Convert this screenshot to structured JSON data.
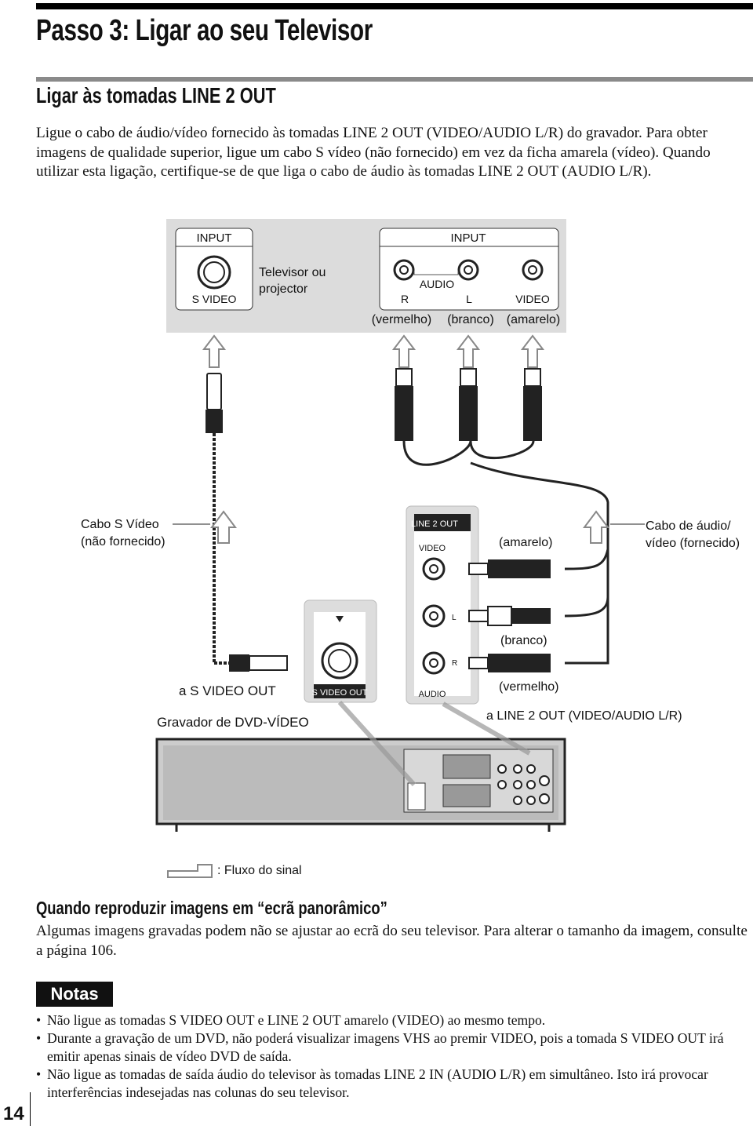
{
  "title": "Passo 3: Ligar ao seu Televisor",
  "section_title": "Ligar às tomadas LINE 2 OUT",
  "intro": "Ligue o cabo de áudio/vídeo fornecido às tomadas LINE 2 OUT (VIDEO/AUDIO L/R) do gravador. Para obter imagens de qualidade superior, ligue um cabo S vídeo (não fornecido) em vez da ficha amarela (vídeo). Quando utilizar esta ligação, certifique-se de que liga o cabo de áudio às tomadas LINE 2 OUT (AUDIO L/R).",
  "diagram": {
    "tv_input_left": "INPUT",
    "tv_input_right": "INPUT",
    "s_video": "S VIDEO",
    "tv_label_1": "Televisor ou",
    "tv_label_2": "projector",
    "audio": "AUDIO",
    "r": "R",
    "l": "L",
    "video": "VIDEO",
    "vermelho": "(vermelho)",
    "branco": "(branco)",
    "amarelo": "(amarelo)",
    "s_cable_1": "Cabo S Vídeo",
    "s_cable_2": "(não fornecido)",
    "av_cable_1": "Cabo de áudio/",
    "av_cable_2": "vídeo (fornecido)",
    "line2out": "LINE 2 OUT",
    "panel_video": "VIDEO",
    "panel_l": "L",
    "panel_r": "R",
    "panel_audio": "AUDIO",
    "s_video_out": "S VIDEO OUT",
    "plug_amarelo": "(amarelo)",
    "plug_branco": "(branco)",
    "plug_vermelho": "(vermelho)",
    "to_s_video_out": "a S VIDEO OUT",
    "recorder": "Gravador de DVD-VÍDEO",
    "to_line2": "a LINE 2 OUT (VIDEO/AUDIO L/R)",
    "legend": ": Fluxo do sinal"
  },
  "widescreen_title": "Quando reproduzir imagens em “ecrã panorâmico”",
  "widescreen_text": "Algumas imagens gravadas podem não se ajustar ao ecrã do seu televisor. Para alterar o tamanho da imagem, consulte a página 106.",
  "notes_label": "Notas",
  "notes": [
    "Não ligue as tomadas S VIDEO OUT e LINE 2 OUT amarelo (VIDEO) ao mesmo tempo.",
    "Durante a gravação de um DVD, não poderá visualizar imagens VHS ao premir VIDEO, pois a tomada S VIDEO OUT irá emitir apenas sinais de vídeo DVD de saída.",
    "Não ligue as tomadas de saída áudio do televisor às tomadas LINE 2 IN (AUDIO L/R) em simultâneo. Isto irá provocar interferências indesejadas nas colunas do seu televisor."
  ],
  "page_number": "14"
}
